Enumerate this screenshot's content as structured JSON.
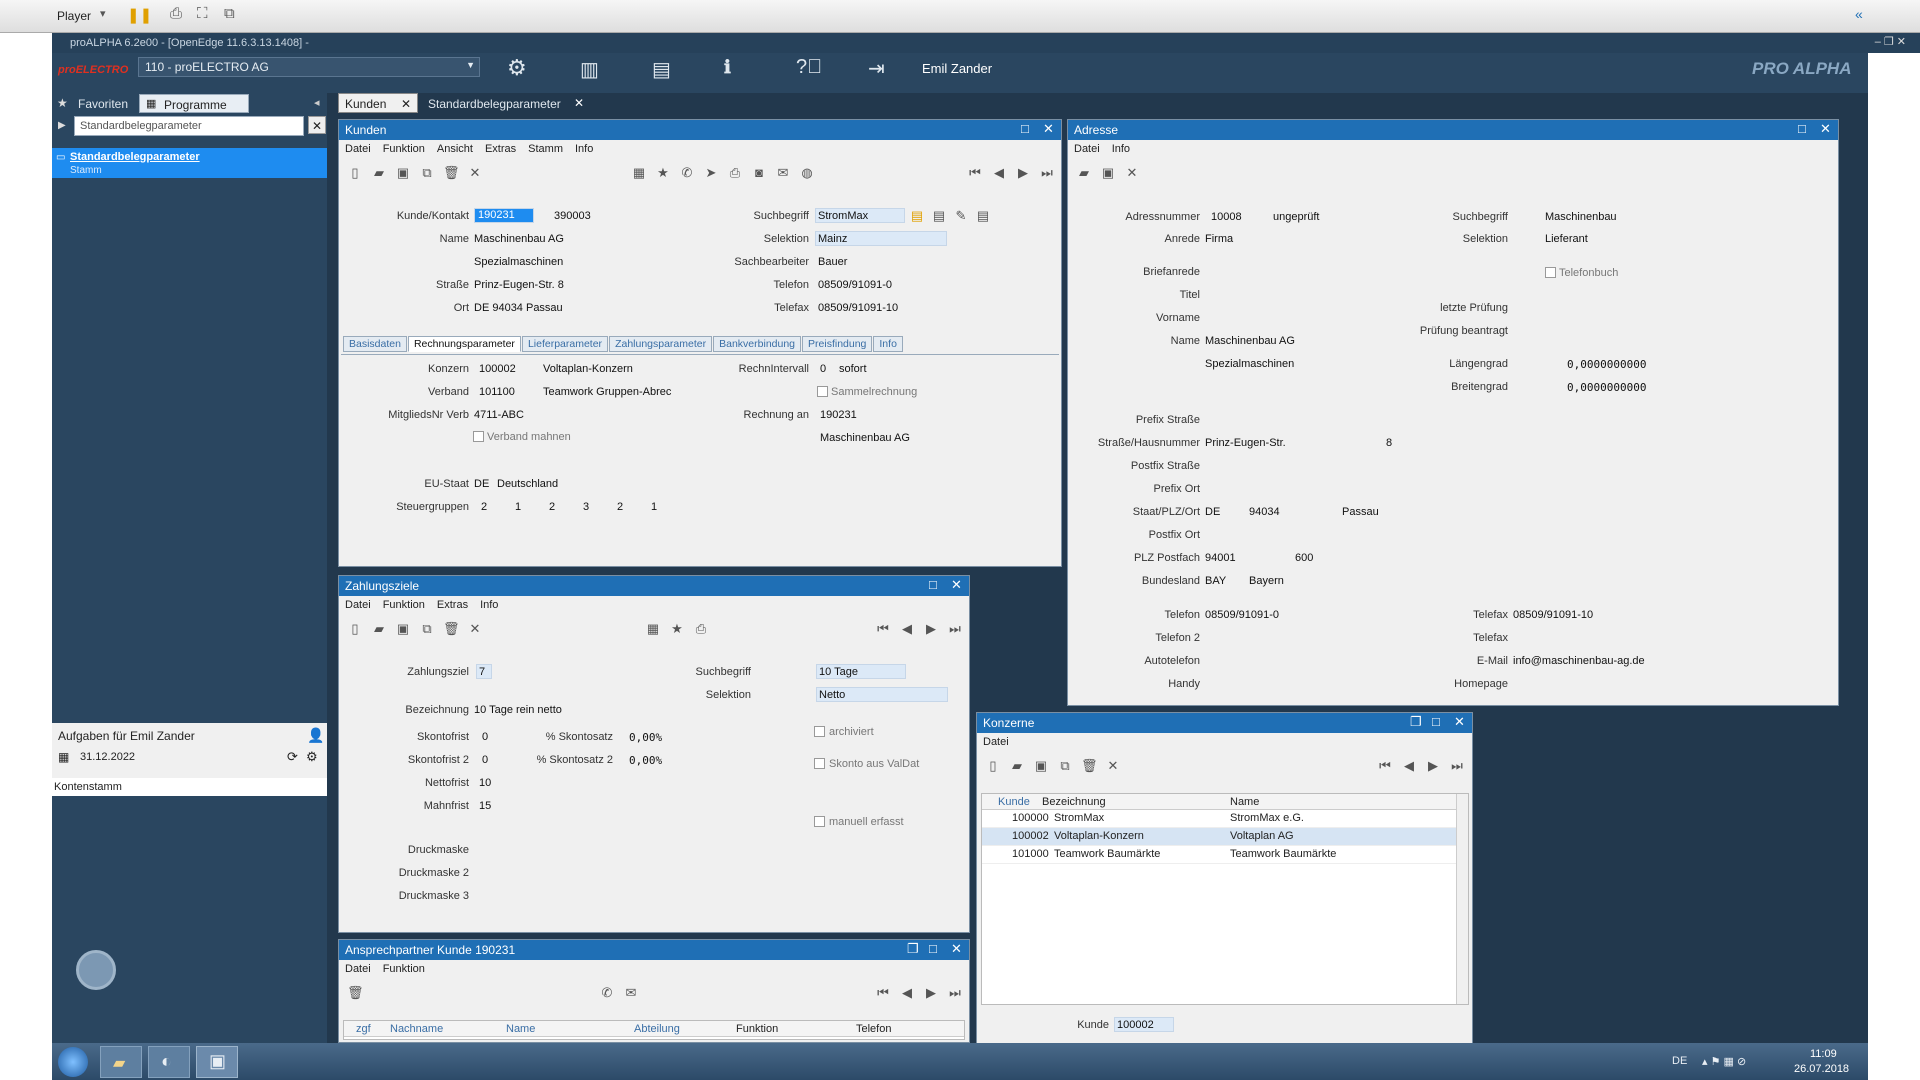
{
  "player": {
    "label": "Player"
  },
  "window": {
    "title": "proALPHA 6.2e00 - [OpenEdge 11.6.3.13.1408] -"
  },
  "app": {
    "logo": "proELECTRO",
    "company_select": "110 - proELECTRO AG",
    "user": "Emil Zander",
    "brand": "PRO ALPHA"
  },
  "main_tabs": [
    {
      "label": "Kunden"
    },
    {
      "label": "Standardbelegparameter"
    }
  ],
  "sidebar": {
    "tab_favorites": "Favoriten",
    "tab_programs": "Programme",
    "search_value": "Standardbelegparameter",
    "result_title": "Standardbelegparameter",
    "result_sub": "Stamm",
    "tasks_title": "Aufgaben für Emil Zander",
    "tasks_date": "31.12.2022",
    "tasks_item": "Kontenstamm"
  },
  "kunden": {
    "title": "Kunden",
    "menu": [
      "Datei",
      "Funktion",
      "Ansicht",
      "Extras",
      "Stamm",
      "Info"
    ],
    "labels": {
      "kunde": "Kunde/Kontakt",
      "name": "Name",
      "strasse": "Straße",
      "ort": "Ort",
      "suchbegriff": "Suchbegriff",
      "selektion": "Selektion",
      "sachbearbeiter": "Sachbearbeiter",
      "telefon": "Telefon",
      "telefax": "Telefax"
    },
    "values": {
      "kunde": "190231",
      "kontakt": "390003",
      "name": "Maschinenbau AG",
      "name2": "Spezialmaschinen",
      "strasse": "Prinz-Eugen-Str. 8",
      "ort": "DE 94034 Passau",
      "suchbegriff": "StromMax",
      "selektion": "Mainz",
      "sachbearbeiter": "Bauer",
      "telefon": "08509/91091-0",
      "telefax": "08509/91091-10"
    },
    "tabs": [
      "Basisdaten",
      "Rechnungsparameter",
      "Lieferparameter",
      "Zahlungsparameter",
      "Bankverbindung",
      "Preisfindung",
      "Info"
    ],
    "rp": {
      "konzern_label": "Konzern",
      "konzern": "100002",
      "konzern_name": "Voltaplan-Konzern",
      "verband_label": "Verband",
      "verband": "101100",
      "verband_name": "Teamwork Gruppen-Abrec",
      "mitglied_label": "MitgliedsNr Verb",
      "mitglied": "4711-ABC",
      "verband_mahnen": "Verband mahnen",
      "intervall_label": "RechnIntervall",
      "intervall": "0",
      "intervall_text": "sofort",
      "sammel": "Sammelrechnung",
      "rechnung_an_label": "Rechnung an",
      "rechnung_an": "190231",
      "rechnung_an_name": "Maschinenbau AG",
      "eu_label": "EU-Staat",
      "eu_code": "DE",
      "eu_name": "Deutschland",
      "steuer_label": "Steuergruppen",
      "steuer": [
        "2",
        "1",
        "2",
        "3",
        "2",
        "1"
      ]
    }
  },
  "adresse": {
    "title": "Adresse",
    "menu": [
      "Datei",
      "Info"
    ],
    "labels": {
      "adressnummer": "Adressnummer",
      "anrede": "Anrede",
      "briefanrede": "Briefanrede",
      "titel": "Titel",
      "vorname": "Vorname",
      "name": "Name",
      "prefix_strasse": "Prefix Straße",
      "strasse_hn": "Straße/Hausnummer",
      "postfix_strasse": "Postfix Straße",
      "prefix_ort": "Prefix Ort",
      "staat": "Staat/PLZ/Ort",
      "postfix_ort": "Postfix Ort",
      "plz_postfach": "PLZ Postfach",
      "bundesland": "Bundesland",
      "telefon": "Telefon",
      "telefon2": "Telefon 2",
      "autotelefon": "Autotelefon",
      "handy": "Handy",
      "suchbegriff": "Suchbegriff",
      "selektion": "Selektion",
      "telefonbuch": "Telefonbuch",
      "letzte_pruefung": "letzte Prüfung",
      "pruefung_beantragt": "Prüfung beantragt",
      "laengengrad": "Längengrad",
      "breitengrad": "Breitengrad",
      "telefax": "Telefax",
      "email": "E-Mail",
      "homepage": "Homepage"
    },
    "values": {
      "adressnummer": "10008",
      "status": "ungeprüft",
      "anrede": "Firma",
      "name": "Maschinenbau AG",
      "name2": "Spezialmaschinen",
      "strasse": "Prinz-Eugen-Str.",
      "hausnummer": "8",
      "staat": "DE",
      "plz": "94034",
      "ort": "Passau",
      "plz_postfach": "94001",
      "postfach": "600",
      "bundesland_code": "BAY",
      "bundesland": "Bayern",
      "telefon": "08509/91091-0",
      "suchbegriff": "Maschinenbau",
      "selektion": "Lieferant",
      "laengengrad": "0,0000000000",
      "breitengrad": "0,0000000000",
      "telefax": "08509/91091-10",
      "email": "info@maschinenbau-ag.de"
    }
  },
  "zahlung": {
    "title": "Zahlungsziele",
    "menu": [
      "Datei",
      "Funktion",
      "Extras",
      "Info"
    ],
    "labels": {
      "ziel": "Zahlungsziel",
      "bezeichnung": "Bezeichnung",
      "skontofrist": "Skontofrist",
      "skontofrist2": "Skontofrist 2",
      "nettofrist": "Nettofrist",
      "mahnfrist": "Mahnfrist",
      "skontosatz": "% Skontosatz",
      "skontosatz2": "% Skontosatz 2",
      "suchbegriff": "Suchbegriff",
      "selektion": "Selektion",
      "archiviert": "archiviert",
      "skonto_valdat": "Skonto aus ValDat",
      "manuell": "manuell erfasst",
      "druck1": "Druckmaske",
      "druck2": "Druckmaske 2",
      "druck3": "Druckmaske 3"
    },
    "values": {
      "ziel": "7",
      "bezeichnung": "10 Tage rein netto",
      "skontofrist": "0",
      "skontofrist2": "0",
      "nettofrist": "10",
      "mahnfrist": "15",
      "skontosatz": "0,00%",
      "skontosatz2": "0,00%",
      "suchbegriff": "10 Tage",
      "selektion": "Netto"
    }
  },
  "konzerne": {
    "title": "Konzerne",
    "menu": [
      "Datei"
    ],
    "columns": [
      "Kunde",
      "Bezeichnung",
      "Name"
    ],
    "rows": [
      {
        "kunde": "100000",
        "bez": "StromMax",
        "name": "StromMax e.G."
      },
      {
        "kunde": "100002",
        "bez": "Voltaplan-Konzern",
        "name": "Voltaplan AG"
      },
      {
        "kunde": "101000",
        "bez": "Teamwork Baumärkte",
        "name": "Teamwork Baumärkte"
      }
    ],
    "footer_label": "Kunde",
    "footer_value": "100002"
  },
  "ansprech": {
    "title": "Ansprechpartner Kunde 190231",
    "menu": [
      "Datei",
      "Funktion"
    ],
    "columns": [
      "zgf",
      "Nachname",
      "Name",
      "Abteilung",
      "Funktion",
      "Telefon"
    ]
  },
  "taskbar": {
    "lang": "DE",
    "time": "11:09",
    "date": "26.07.2018"
  }
}
